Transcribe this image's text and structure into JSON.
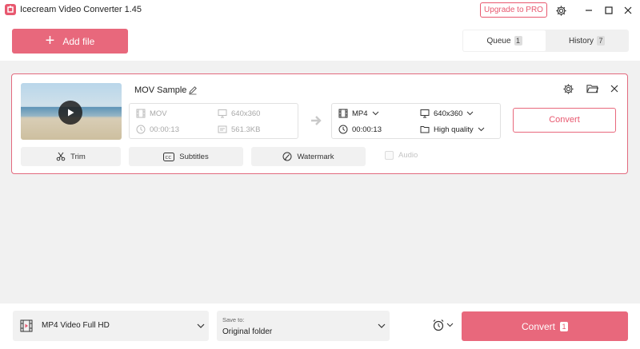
{
  "window": {
    "title": "Icecream Video Converter 1.45",
    "upgrade_label": "Upgrade to PRO"
  },
  "header": {
    "add_file_label": "Add file",
    "tabs": [
      {
        "label": "Queue",
        "count": "1",
        "active": true
      },
      {
        "label": "History",
        "count": "7",
        "active": false
      }
    ]
  },
  "queue_item": {
    "file_name": "MOV Sample",
    "source": {
      "format": "MOV",
      "resolution": "640x360",
      "duration": "00:00:13",
      "size": "561.3KB"
    },
    "output": {
      "format": "MP4",
      "resolution": "640x360",
      "duration": "00:00:13",
      "quality": "High quality"
    },
    "convert_label": "Convert",
    "tools": {
      "trim": "Trim",
      "subtitles": "Subtitles",
      "watermark": "Watermark",
      "audio": "Audio"
    }
  },
  "bottom": {
    "format_preset": "MP4 Video Full HD",
    "save_to_label": "Save to:",
    "save_to_value": "Original folder",
    "convert_label": "Convert",
    "convert_count": "1"
  },
  "colors": {
    "accent": "#e8687c",
    "accent_text": "#e8586f",
    "background": "#f1f1f1"
  }
}
